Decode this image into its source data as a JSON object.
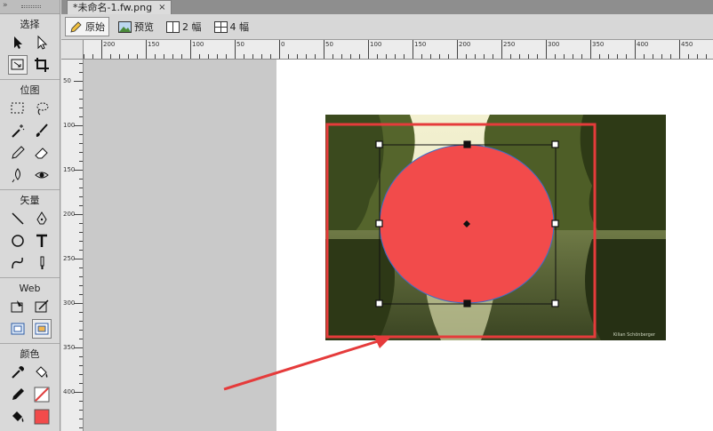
{
  "tools": {
    "section_select": "选择",
    "section_bitmap": "位图",
    "section_vector": "矢量",
    "section_web": "Web",
    "section_color": "颜色"
  },
  "tab": {
    "title": "*未命名-1.fw.png",
    "close": "×"
  },
  "viewbar": {
    "original": "原始",
    "preview": "预览",
    "two_up": "2 幅",
    "four_up": "4 幅"
  },
  "ruler": {
    "h_labels": [
      "200",
      "150",
      "100",
      "50",
      "0",
      "50",
      "100",
      "150",
      "200",
      "250",
      "300",
      "350",
      "400",
      "450"
    ],
    "v_labels": [
      "50",
      "100",
      "150",
      "200",
      "250",
      "300",
      "350",
      "400"
    ]
  },
  "canvas": {
    "photo_credit": "Kilian Schönberger"
  },
  "colors": {
    "ellipse_fill": "#f24b4b",
    "highlight_red": "#e53b3b",
    "stroke_swatch": "#e04040"
  }
}
